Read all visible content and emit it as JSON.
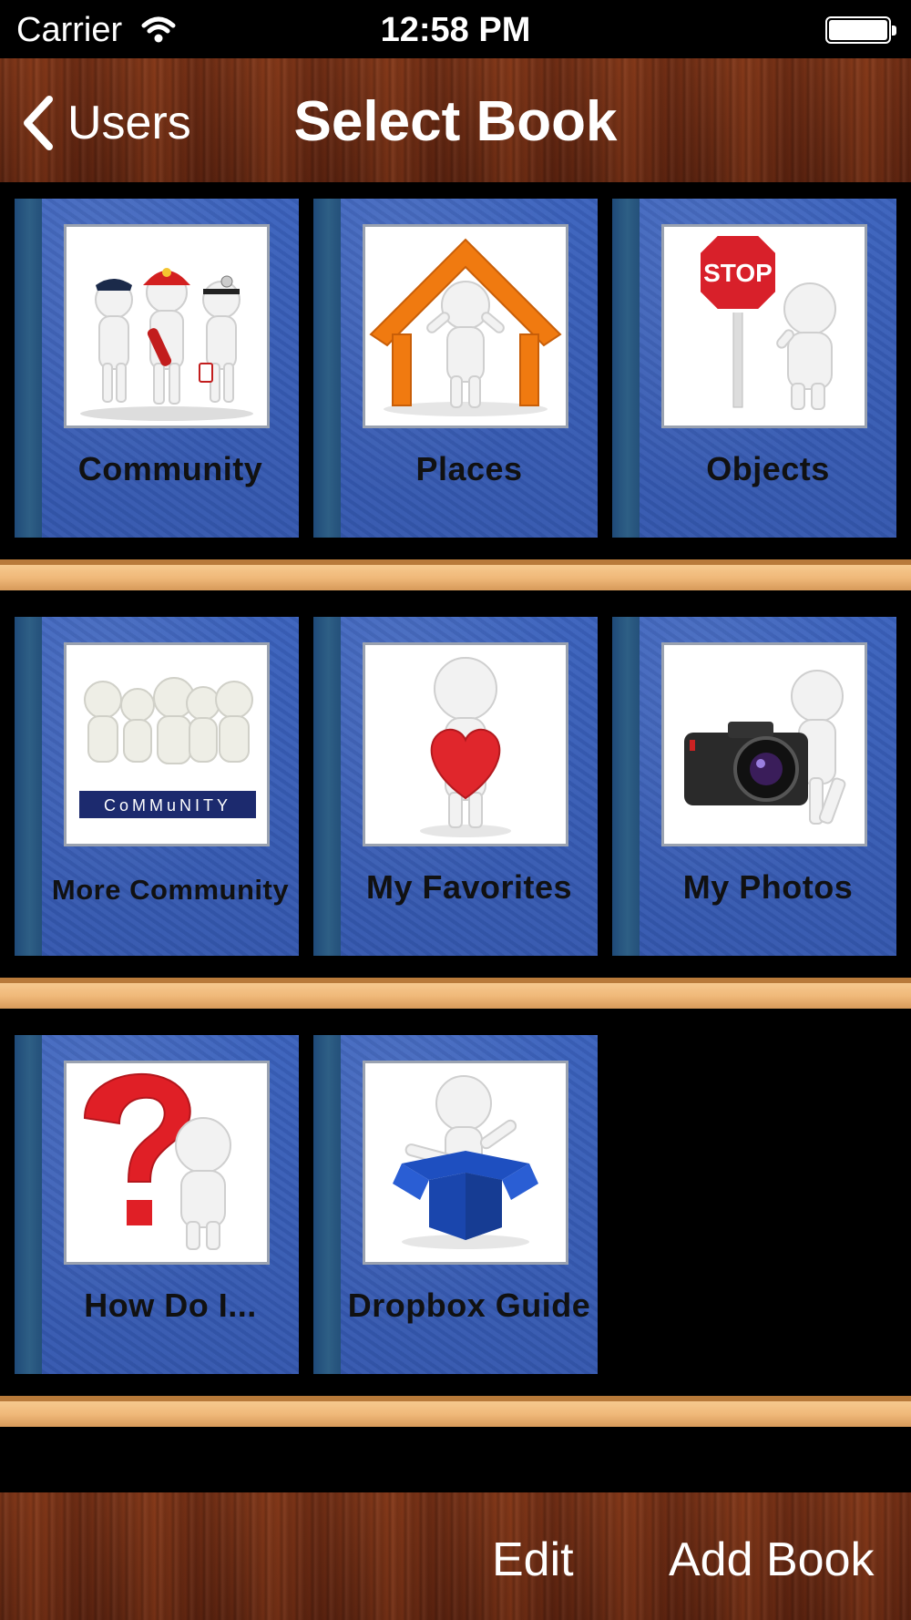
{
  "status_bar": {
    "carrier": "Carrier",
    "time": "12:58 PM"
  },
  "nav": {
    "back_label": "Users",
    "title": "Select Book"
  },
  "shelves": [
    {
      "books": [
        {
          "label": "Community",
          "icon": "community-workers-icon"
        },
        {
          "label": "Places",
          "icon": "house-icon"
        },
        {
          "label": "Objects",
          "icon": "stop-sign-icon"
        }
      ]
    },
    {
      "books": [
        {
          "label": "More Community",
          "icon": "group-people-icon",
          "cover_text": "CoMMuNITY"
        },
        {
          "label": "My Favorites",
          "icon": "heart-icon"
        },
        {
          "label": "My Photos",
          "icon": "camera-icon"
        }
      ]
    },
    {
      "books": [
        {
          "label": "How Do I...",
          "icon": "question-mark-icon"
        },
        {
          "label": "Dropbox Guide",
          "icon": "dropbox-icon"
        }
      ]
    }
  ],
  "toolbar": {
    "edit_label": "Edit",
    "add_label": "Add Book"
  },
  "colors": {
    "book_blue": "#3a5fb8",
    "shelf": "#f0b97a",
    "wood": "#6a2a12"
  }
}
